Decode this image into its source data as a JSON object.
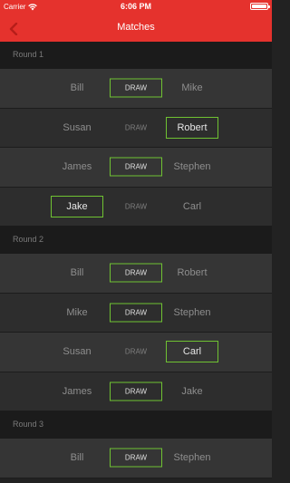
{
  "status": {
    "carrier": "Carrier",
    "time": "6:06 PM",
    "battery_level": 1.0
  },
  "nav": {
    "title": "Matches",
    "back_icon": "chevron-left-icon"
  },
  "colors": {
    "accent": "#e5322d",
    "selected": "#6fc232"
  },
  "rounds": [
    {
      "label": "Round 1",
      "matches": [
        {
          "left": "Bill",
          "right": "Mike",
          "draw": "DRAW",
          "selected": "draw"
        },
        {
          "left": "Susan",
          "right": "Robert",
          "draw": "DRAW",
          "selected": "right"
        },
        {
          "left": "James",
          "right": "Stephen",
          "draw": "DRAW",
          "selected": "draw"
        },
        {
          "left": "Jake",
          "right": "Carl",
          "draw": "DRAW",
          "selected": "left"
        }
      ]
    },
    {
      "label": "Round 2",
      "matches": [
        {
          "left": "Bill",
          "right": "Robert",
          "draw": "DRAW",
          "selected": "draw"
        },
        {
          "left": "Mike",
          "right": "Stephen",
          "draw": "DRAW",
          "selected": "draw"
        },
        {
          "left": "Susan",
          "right": "Carl",
          "draw": "DRAW",
          "selected": "right"
        },
        {
          "left": "James",
          "right": "Jake",
          "draw": "DRAW",
          "selected": "draw"
        }
      ]
    },
    {
      "label": "Round 3",
      "matches": [
        {
          "left": "Bill",
          "right": "Stephen",
          "draw": "DRAW",
          "selected": "draw"
        }
      ]
    }
  ]
}
